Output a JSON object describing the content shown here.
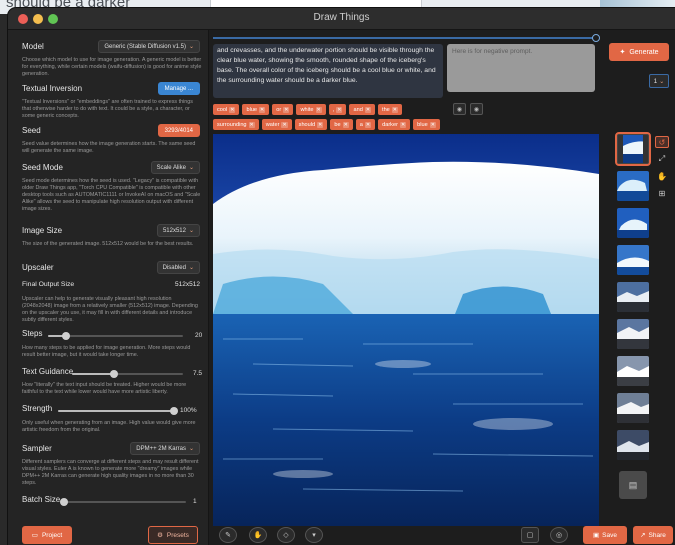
{
  "background": {
    "snippet": "should be a darker"
  },
  "window": {
    "title": "Draw Things"
  },
  "sidebar": {
    "model": {
      "label": "Model",
      "value": "Generic (Stable Diffusion v1.5)",
      "desc": "Choose which model to use for image generation. A generic model is better for everything, while certain models (waifu-diffusion) is good for anime style generation."
    },
    "textual_inversion": {
      "label": "Textual Inversion",
      "button": "Manage ...",
      "desc": "\"Textual Inversions\" or \"embeddings\" are often trained to express things that otherwise harder to do with text. It could be a style, a character, or some generic concepts."
    },
    "seed": {
      "label": "Seed",
      "value": "3293/4014",
      "desc": "Seed value determines how the image generation starts. The same seed will generate the same image."
    },
    "seed_mode": {
      "label": "Seed Mode",
      "value": "Scale Alike",
      "desc": "Seed mode determines how the seed is used. \"Legacy\" is compatible with older Draw Things app, \"Torch CPU Compatible\" is compatible with other desktop tools such as AUTOMATIC1111 or InvokeAI on macOS and \"Scale Alike\" allows the seed to manipulate high resolution output with different image sizes."
    },
    "image_size": {
      "label": "Image Size",
      "value": "512x512",
      "desc": "The size of the generated image. 512x512 would be for the best results."
    },
    "upscaler": {
      "label": "Upscaler",
      "value": "Disabled"
    },
    "final_output": {
      "label": "Final Output Size",
      "value": "512x512",
      "desc": "Upscaler can help to generate visually pleasant high resolution (2048x2048) image from a relatively smaller (512x512) image. Depending on the upscaler you use, it may fill in with different details and introduce subtly different styles."
    },
    "steps": {
      "label": "Steps",
      "value": "20",
      "fraction": 0.13,
      "desc": "How many steps to be applied for image generation. More steps would result better image, but it would take longer time."
    },
    "text_guidance": {
      "label": "Text Guidance",
      "value": "7.5",
      "fraction": 0.38,
      "desc": "How \"literally\" the text input should be treated. Higher would be more faithful to the text while lower would have more artistic liberty."
    },
    "strength": {
      "label": "Strength",
      "value": "100%",
      "fraction": 1.0,
      "desc": "Only useful when generating from an image. High value would give more artistic freedom from the original."
    },
    "sampler": {
      "label": "Sampler",
      "value": "DPM++ 2M Karras",
      "desc": "Different samplers can converge at different steps and may result different visual styles. Euler A is known to generate more \"dreamy\" images while DPM++ 2M Karras can generate high quality images in no more than 30 steps."
    },
    "batch_size": {
      "label": "Batch Size",
      "value": "1",
      "fraction": 0.0
    },
    "project_button": "Project",
    "presets_button": "Presets"
  },
  "main": {
    "prompt_text": "and crevasses, and the underwater portion should be visible through the clear blue water, showing the smooth, rounded shape of the iceberg's base. The overall color of the iceberg should be a cool blue or white, and the surrounding water should be a darker blue.",
    "negative_placeholder": "Here is for negative prompt.",
    "generate_button": "Generate",
    "batch_count": "1",
    "chips_row1": [
      "cool",
      "blue",
      "or",
      "white",
      ",",
      "and",
      "the"
    ],
    "chips_row2": [
      "surrounding",
      "water",
      "should",
      "be",
      "a",
      "darker",
      "blue"
    ],
    "save_button": "Save",
    "share_button": "Share"
  },
  "icons": {
    "generate": "sparkle-icon",
    "project": "folder-icon",
    "presets": "gear-icon",
    "history": "history-icon",
    "expand": "expand-icon",
    "hand": "hand-icon",
    "grid": "grid-icon",
    "eraser": "eraser-icon",
    "brush": "brush-icon",
    "trash": "trash-icon",
    "camera": "camera-icon",
    "note": "note-icon"
  },
  "colors": {
    "accent": "#e16745",
    "blue": "#3a86d3",
    "panel": "#242424",
    "background": "#1d1d1d"
  }
}
